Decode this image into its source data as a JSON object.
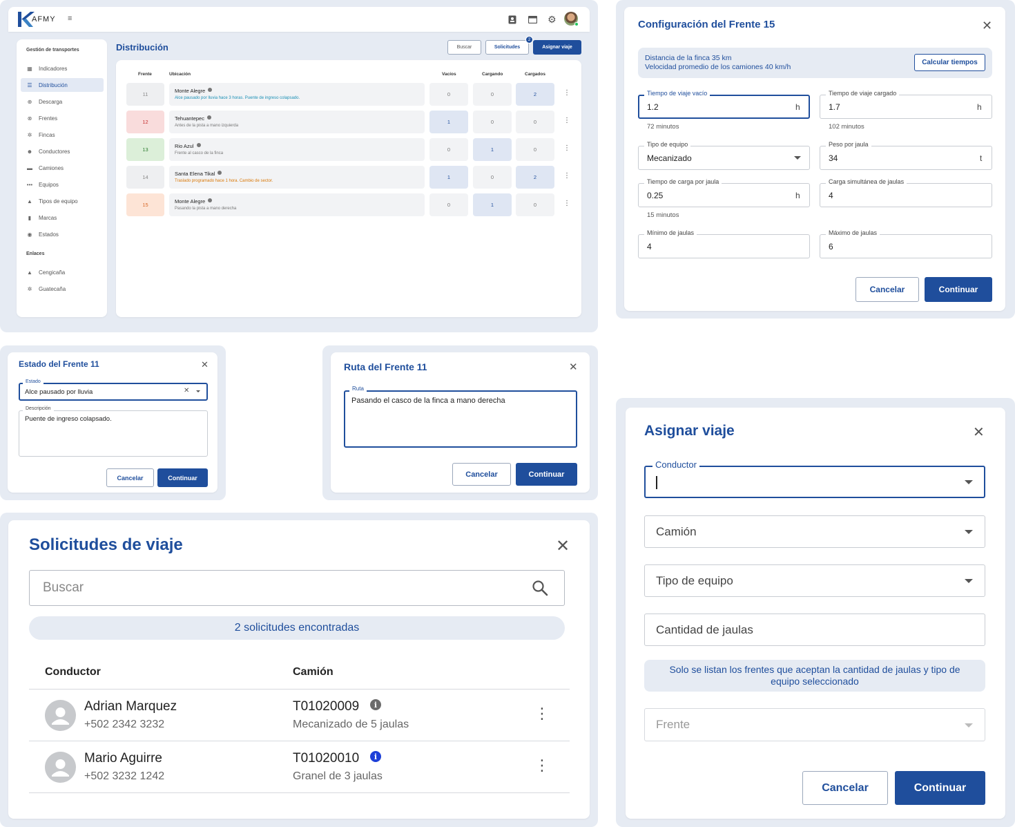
{
  "dashboard": {
    "logo": "AFMY",
    "sidebar": {
      "section_title": "Gestión de transportes",
      "items": [
        {
          "label": "Indicadores",
          "icon": "dashboard-icon"
        },
        {
          "label": "Distribución",
          "icon": "list-icon",
          "active": true
        },
        {
          "label": "Descarga",
          "icon": "download-icon"
        },
        {
          "label": "Frentes",
          "icon": "binoculars-icon"
        },
        {
          "label": "Fincas",
          "icon": "plant-icon"
        },
        {
          "label": "Conductores",
          "icon": "people-icon"
        },
        {
          "label": "Camiones",
          "icon": "truck-icon"
        },
        {
          "label": "Equipos",
          "icon": "dots-icon"
        },
        {
          "label": "Tipos de equipo",
          "icon": "category-icon"
        },
        {
          "label": "Marcas",
          "icon": "barcode-icon"
        },
        {
          "label": "Estados",
          "icon": "status-icon"
        }
      ],
      "links_title": "Enlaces",
      "links": [
        {
          "label": "Cengicaña",
          "icon": "mountain-icon"
        },
        {
          "label": "Guatecaña",
          "icon": "plant-icon"
        }
      ]
    },
    "page_title": "Distribución",
    "buttons": {
      "search": "Buscar",
      "requests": "Solicitudes",
      "requests_badge": "2",
      "assign": "Asignar viaje"
    },
    "table": {
      "headers": {
        "frente": "Frente",
        "ubicacion": "Ubicación",
        "vacios": "Vacíos",
        "cargando": "Cargando",
        "cargados": "Cargados"
      },
      "rows": [
        {
          "frente": "11",
          "frente_style": "gray",
          "name": "Monte Alegre",
          "desc": "Alce pausado por lluvia hace 3 horas. Puente de ingreso colapsado.",
          "desc_color": "#1a8fb5",
          "vacios": "0",
          "cargando": "0",
          "cargados": "2",
          "hl": [
            false,
            false,
            true
          ]
        },
        {
          "frente": "12",
          "frente_style": "red",
          "name": "Tehuantepec",
          "desc": "Antes de la pista a mano izquierda",
          "desc_color": "#777777",
          "vacios": "1",
          "cargando": "0",
          "cargados": "0",
          "hl": [
            true,
            false,
            false
          ]
        },
        {
          "frente": "13",
          "frente_style": "green",
          "name": "Rio Azul",
          "desc": "Frente al casco de la finca",
          "desc_color": "#777777",
          "vacios": "0",
          "cargando": "1",
          "cargados": "0",
          "hl": [
            false,
            true,
            false
          ]
        },
        {
          "frente": "14",
          "frente_style": "gray",
          "name": "Santa Elena Tikal",
          "desc": "Traslado programado hace 1 hora. Cambio de sector.",
          "desc_color": "#d97706",
          "vacios": "1",
          "cargando": "0",
          "cargados": "2",
          "hl": [
            true,
            false,
            true
          ]
        },
        {
          "frente": "15",
          "frente_style": "orange",
          "name": "Monte Alegre",
          "desc": "Pasando la pista a mano derecha",
          "desc_color": "#777777",
          "vacios": "0",
          "cargando": "1",
          "cargados": "0",
          "hl": [
            false,
            true,
            false
          ]
        }
      ]
    }
  },
  "config_dialog": {
    "title": "Configuración del Frente 15",
    "info_line1": "Distancia de la finca 35 km",
    "info_line2": "Velocidad promedio de los camiones 40 km/h",
    "calc_button": "Calcular tiempos",
    "fields": {
      "empty_time": {
        "label": "Tiempo de viaje vacío",
        "value": "1.2",
        "suffix": "h",
        "helper": "72 minutos"
      },
      "loaded_time": {
        "label": "Tiempo de viaje cargado",
        "value": "1.7",
        "suffix": "h",
        "helper": "102 minutos"
      },
      "equipment": {
        "label": "Tipo de equipo",
        "value": "Mecanizado"
      },
      "weight": {
        "label": "Peso por jaula",
        "value": "34",
        "suffix": "t"
      },
      "load_time": {
        "label": "Tiempo de carga por jaula",
        "value": "0.25",
        "suffix": "h",
        "helper": "15 minutos"
      },
      "simultaneous": {
        "label": "Carga simultánea de jaulas",
        "value": "4"
      },
      "min_cages": {
        "label": "Mínimo de jaulas",
        "value": "4"
      },
      "max_cages": {
        "label": "Máximo de jaulas",
        "value": "6"
      }
    },
    "cancel": "Cancelar",
    "continue": "Continuar"
  },
  "state_dialog": {
    "title": "Estado del Frente 11",
    "state_label": "Estado",
    "state_value": "Alce pausado por lluvia",
    "desc_label": "Descripción",
    "desc_value": "Puente de ingreso colapsado.",
    "cancel": "Cancelar",
    "continue": "Continuar"
  },
  "route_dialog": {
    "title": "Ruta del Frente 11",
    "route_label": "Ruta",
    "route_value": "Pasando el casco de la finca a mano derecha",
    "cancel": "Cancelar",
    "continue": "Continuar"
  },
  "requests_dialog": {
    "title": "Solicitudes de viaje",
    "search_placeholder": "Buscar",
    "found": "2 solicitudes encontradas",
    "col_driver": "Conductor",
    "col_truck": "Camión",
    "rows": [
      {
        "name": "Adrian Marquez",
        "phone": "+502 2342 3232",
        "truck": "T01020009",
        "truck_desc": "Mecanizado de 5 jaulas",
        "info_color": "#6b6b6b"
      },
      {
        "name": "Mario Aguirre",
        "phone": "+502 3232 1242",
        "truck": "T01020010",
        "truck_desc": "Granel de 3 jaulas",
        "info_color": "#1e40d8"
      }
    ]
  },
  "assign_dialog": {
    "title": "Asignar viaje",
    "driver_label": "Conductor",
    "truck_placeholder": "Camión",
    "equipment_placeholder": "Tipo de equipo",
    "cages_placeholder": "Cantidad de jaulas",
    "note": "Solo se listan los frentes que aceptan la cantidad de jaulas y tipo de equipo seleccionado",
    "front_placeholder": "Frente",
    "cancel": "Cancelar",
    "continue": "Continuar"
  }
}
